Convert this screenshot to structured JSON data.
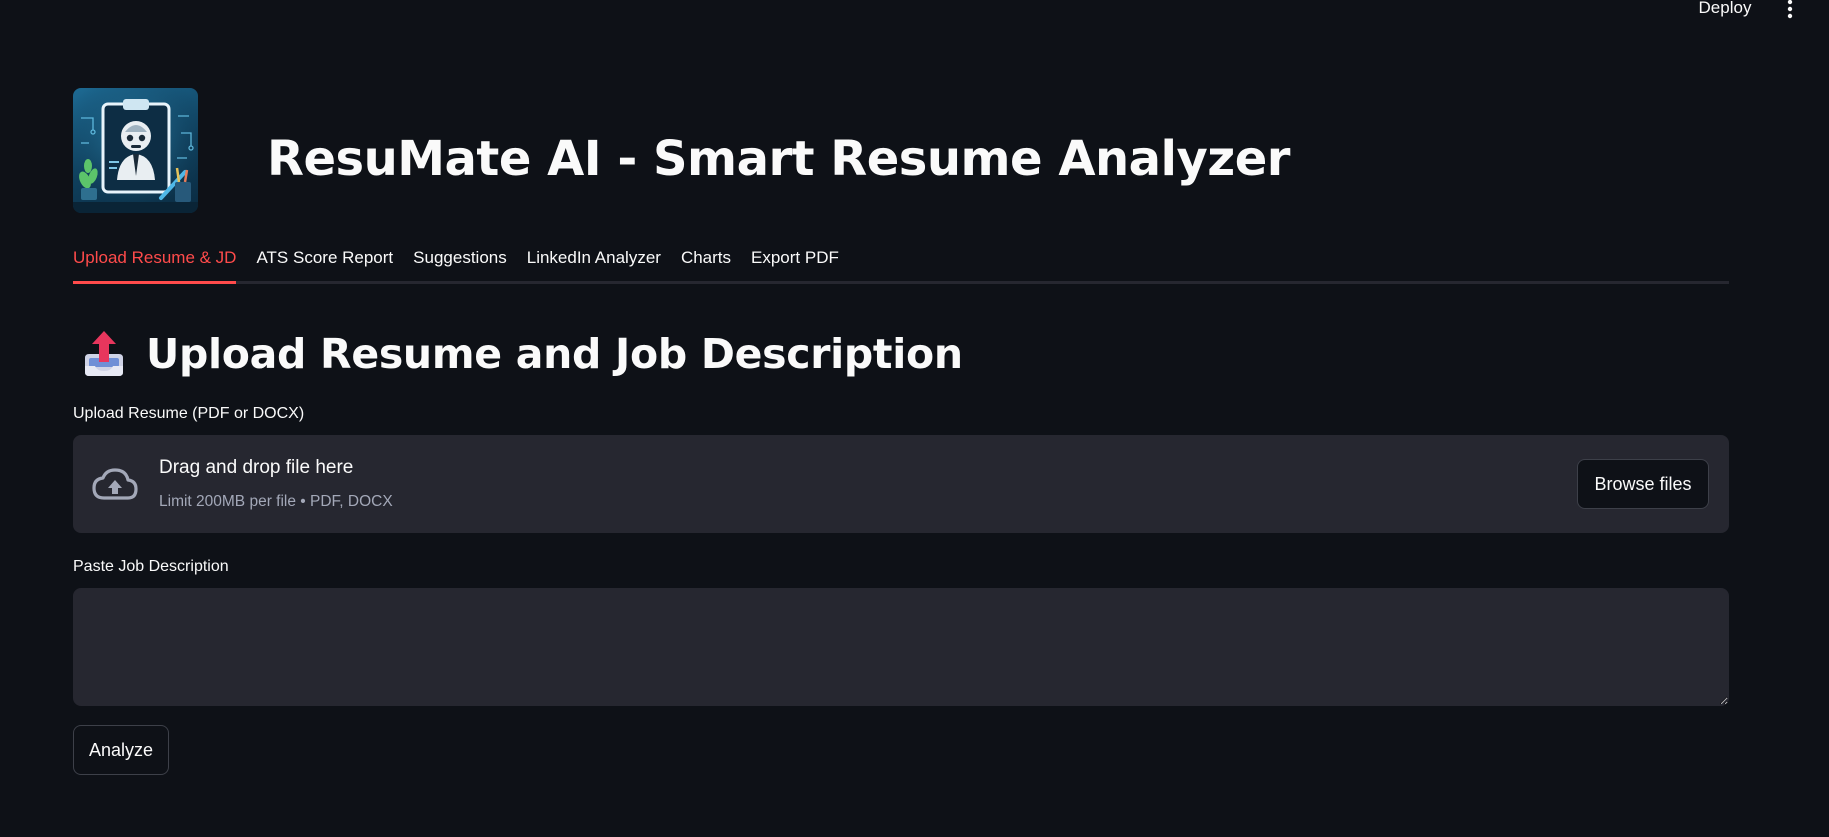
{
  "header": {
    "deploy_label": "Deploy",
    "menu_icon": "kebab-menu-icon"
  },
  "app": {
    "logo_icon": "robot-clipboard-logo",
    "title": "ResuMate AI - Smart Resume Analyzer"
  },
  "tabs": [
    {
      "label": "Upload Resume & JD",
      "active": true
    },
    {
      "label": "ATS Score Report",
      "active": false
    },
    {
      "label": "Suggestions",
      "active": false
    },
    {
      "label": "LinkedIn Analyzer",
      "active": false
    },
    {
      "label": "Charts",
      "active": false
    },
    {
      "label": "Export PDF",
      "active": false
    }
  ],
  "section": {
    "icon": "outbox-tray-icon",
    "title": "Upload Resume and Job Description"
  },
  "resume_upload": {
    "label": "Upload Resume (PDF or DOCX)",
    "dropzone_text": "Drag and drop file here",
    "limit_text": "Limit 200MB per file • PDF, DOCX",
    "browse_label": "Browse files",
    "icon": "cloud-upload-icon"
  },
  "job_description": {
    "label": "Paste Job Description",
    "value": "",
    "placeholder": ""
  },
  "analyze_button": {
    "label": "Analyze"
  },
  "colors": {
    "background": "#0e1117",
    "surface": "#262730",
    "accent": "#ff4b4b",
    "text": "#fafafa",
    "muted_text": "#a3a8b8"
  }
}
